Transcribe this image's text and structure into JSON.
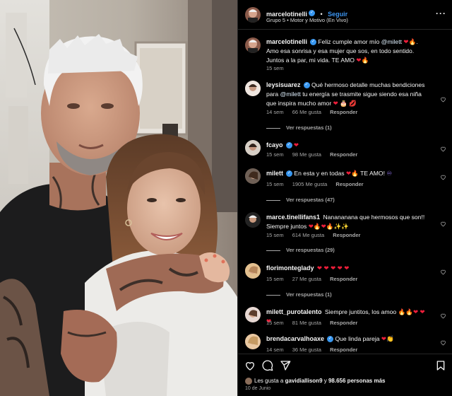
{
  "post": {
    "author": "marcelotinelli",
    "follow_label": "Seguir",
    "subtitle": "Grupo 5 • Motor y Motivo (En Vivo)",
    "caption_author": "marcelotinelli",
    "caption_mention": "@milett",
    "caption_pre": "Feliz cumple amor mío",
    "caption_post": "Amo esa sonrisa y esa mujer que sos, en todo sentido. Juntos a la par, mi vida. TE AMO",
    "caption_time": "15 sem",
    "likes_prefix": "Les gusta a",
    "likes_user": "gavidiallison9",
    "likes_and": "y",
    "likes_count": "98.656 personas más",
    "date": "10 de Junio"
  },
  "comments": [
    {
      "user": "leysisuarez",
      "verified": true,
      "text_pre": "Qué hermoso detalle muchas bendiciones para",
      "mention": "@milett",
      "text_post": "tu energía se trasmite sigue siendo esa niña que inspira mucho amor",
      "time": "14 sem",
      "likes": "66 Me gusta",
      "reply": "Responder",
      "replies": "Ver respuestas (1)"
    },
    {
      "user": "fcayo",
      "verified": true,
      "text_pre": "",
      "mention": "",
      "text_post": "",
      "time": "15 sem",
      "likes": "98 Me gusta",
      "reply": "Responder",
      "replies": ""
    },
    {
      "user": "milett",
      "verified": true,
      "text_pre": "En esta y en todas",
      "mention": "",
      "text_post": "TE AMO!",
      "time": "15 sem",
      "likes": "1905 Me gusta",
      "reply": "Responder",
      "replies": "Ver respuestas (47)"
    },
    {
      "user": "marce.tinellifans1",
      "verified": false,
      "text_pre": "Nanananana que hermosos que son!! Siempre juntos",
      "mention": "",
      "text_post": "",
      "time": "15 sem",
      "likes": "614 Me gusta",
      "reply": "Responder",
      "replies": "Ver respuestas (29)"
    },
    {
      "user": "florimonteglady",
      "verified": false,
      "text_pre": "",
      "mention": "",
      "text_post": "",
      "time": "15 sem",
      "likes": "27 Me gusta",
      "reply": "Responder",
      "replies": "Ver respuestas (1)"
    },
    {
      "user": "milett_purotalento",
      "verified": false,
      "text_pre": "Siempre juntitos, los amoo",
      "mention": "",
      "text_post": "",
      "time": "15 sem",
      "likes": "81 Me gusta",
      "reply": "Responder",
      "replies": ""
    },
    {
      "user": "brendacarvalhoaxe",
      "verified": true,
      "text_pre": "Que linda pareja",
      "mention": "",
      "text_post": "",
      "time": "14 sem",
      "likes": "36 Me gusta",
      "reply": "Responder",
      "replies": ""
    }
  ],
  "icons": {
    "like": "heart-icon",
    "comment": "comment-icon",
    "share": "share-icon",
    "save": "bookmark-icon",
    "more": "more-icon"
  },
  "colors": {
    "background": "#000000",
    "text": "#f5f5f5",
    "secondary": "#a8a8a8",
    "link": "#3d96f2",
    "verified": "#3897f0",
    "heart": "#ed1e3a"
  }
}
